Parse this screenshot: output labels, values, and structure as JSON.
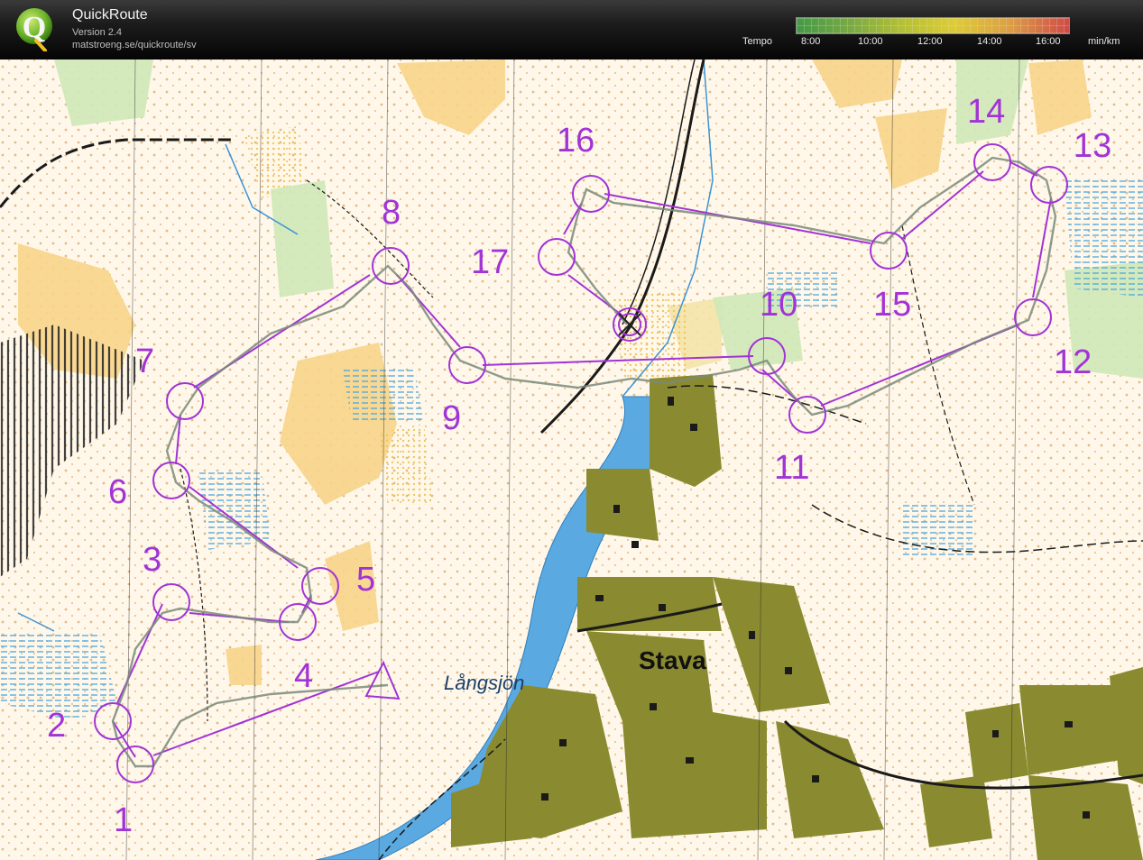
{
  "header": {
    "app_title": "QuickRoute",
    "version": "Version 2.4",
    "url": "matstroeng.se/quickroute/sv",
    "logo_letter": "Q"
  },
  "legend": {
    "label": "Tempo",
    "ticks": [
      "8:00",
      "10:00",
      "12:00",
      "14:00",
      "16:00"
    ],
    "unit": "min/km"
  },
  "map": {
    "place_stava": "Stava",
    "place_langsjon": "Långsjön",
    "control_numbers": [
      "1",
      "2",
      "3",
      "4",
      "5",
      "6",
      "7",
      "8",
      "9",
      "10",
      "11",
      "12",
      "13",
      "14",
      "15",
      "16",
      "17"
    ],
    "colors": {
      "course": "#a233d6",
      "water": "#5aa9e0",
      "settlement": "#8a8a30",
      "open_land": "#f8d48a",
      "forest_green": "#c8e6b0"
    }
  }
}
